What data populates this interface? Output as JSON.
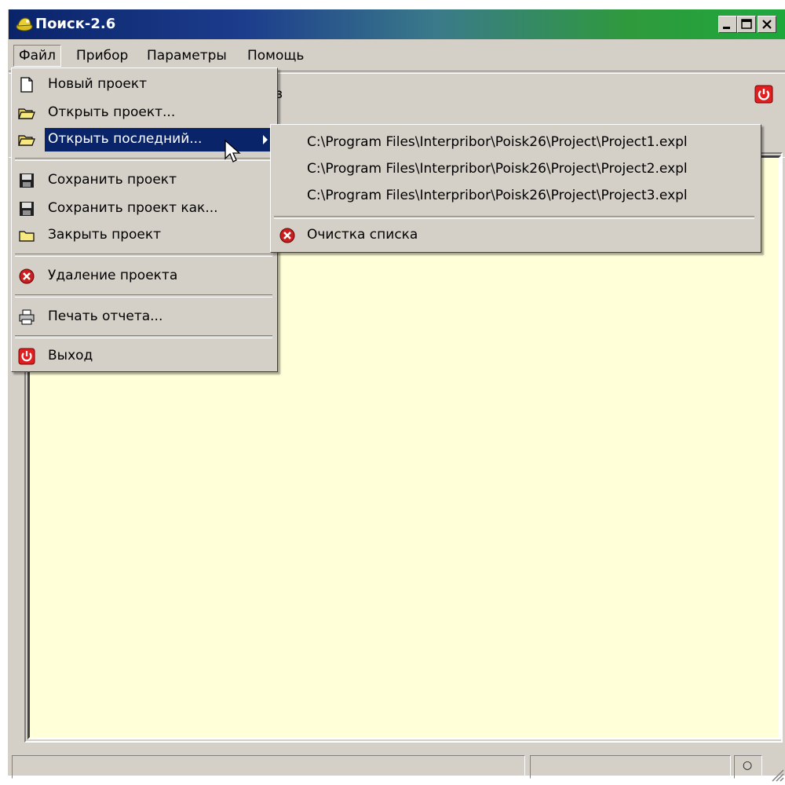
{
  "window": {
    "title": "Поиск-2.6",
    "title_icon": "helmet-icon",
    "minimize_icon": "minimize-icon",
    "maximize_icon": "maximize-icon",
    "close_icon": "close-icon"
  },
  "menubar": {
    "items": [
      "Файл",
      "Прибор",
      "Параметры",
      "Помощь"
    ],
    "active": "Файл"
  },
  "toolbar": {
    "partial_glyph": "з",
    "power_icon": "power-icon"
  },
  "file_menu": {
    "items": [
      {
        "label": "Новый проект",
        "icon": "new-document-icon"
      },
      {
        "label": "Открыть проект...",
        "icon": "open-folder-icon"
      },
      {
        "label": "Открыть последний...",
        "icon": "open-folder-icon",
        "submenu": true,
        "highlighted": true
      },
      {
        "label": "Сохранить проект",
        "icon": "floppy-disk-icon"
      },
      {
        "label": "Сохранить проект как...",
        "icon": "floppy-disk-icon"
      },
      {
        "label": "Закрыть проект",
        "icon": "closed-folder-icon"
      },
      {
        "label": "Удаление проекта",
        "icon": "delete-icon"
      },
      {
        "label": "Печать отчета...",
        "icon": "printer-icon"
      },
      {
        "label": "Выход",
        "icon": "power-icon"
      }
    ]
  },
  "recent_submenu": {
    "files": [
      "C:\\Program Files\\Interpribor\\Poisk26\\Project\\Project1.expl",
      "C:\\Program Files\\Interpribor\\Poisk26\\Project\\Project2.expl",
      "C:\\Program Files\\Interpribor\\Poisk26\\Project\\Project3.expl"
    ],
    "clear_label": "Очистка списка",
    "clear_icon": "delete-icon"
  },
  "statusbar": {
    "indicator": "○"
  },
  "colors": {
    "face": "#d4d0c8",
    "highlight": "#0a246a",
    "content_bg": "#ffffd8",
    "title_gradient_start": "#0a246a",
    "title_gradient_end": "#1ea83c"
  }
}
